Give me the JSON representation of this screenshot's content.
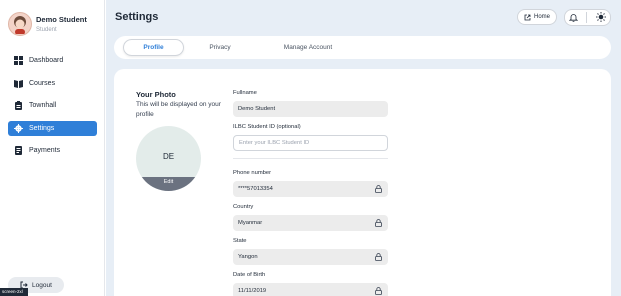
{
  "user": {
    "name": "Demo Student",
    "role": "Student"
  },
  "nav": {
    "items": [
      {
        "label": "Dashboard",
        "icon": "dashboard-icon"
      },
      {
        "label": "Courses",
        "icon": "book-icon"
      },
      {
        "label": "Townhall",
        "icon": "clipboard-icon"
      },
      {
        "label": "Settings",
        "icon": "gear-icon",
        "active": true
      },
      {
        "label": "Payments",
        "icon": "receipt-icon"
      }
    ],
    "logout_label": "Logout"
  },
  "header": {
    "title": "Settings",
    "home_label": "Home"
  },
  "tabs": [
    {
      "label": "Profile",
      "active": true
    },
    {
      "label": "Privacy"
    },
    {
      "label": "Manage Account"
    }
  ],
  "photo": {
    "title": "Your Photo",
    "description": "This will be displayed on your profile",
    "initials": "DE",
    "edit_label": "Edit"
  },
  "form": {
    "fullname": {
      "label": "Fullname",
      "value": "Demo Student"
    },
    "student_id": {
      "label": "ILBC Student ID (optional)",
      "placeholder": "Enter your ILBC Student ID"
    },
    "phone": {
      "label": "Phone number",
      "value": "****57013354"
    },
    "country": {
      "label": "Country",
      "value": "Myanmar"
    },
    "state": {
      "label": "State",
      "value": "Yangon"
    },
    "dob": {
      "label": "Date of Birth",
      "value": "11/11/2019"
    }
  },
  "screen_tag": "screen-2xl",
  "colors": {
    "accent": "#2f7fd8",
    "main_bg": "#e7eef6",
    "field_bg": "#ececec"
  }
}
